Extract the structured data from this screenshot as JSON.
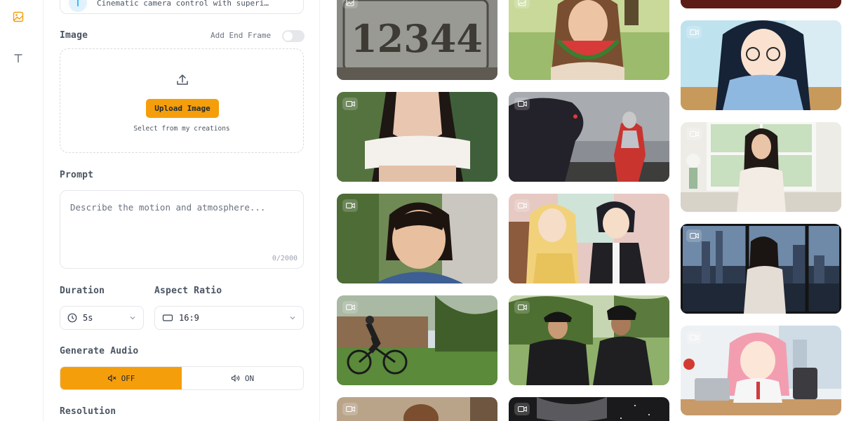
{
  "rail": {
    "items": [
      {
        "icon": "image-icon",
        "active": true
      },
      {
        "icon": "text-icon",
        "active": false
      }
    ]
  },
  "model": {
    "description": "Cinematic camera control with superi…"
  },
  "image_section": {
    "label": "Image",
    "end_frame_label": "Add End Frame",
    "end_frame_enabled": false,
    "upload_button": "Upload Image",
    "select_link": "Select from my creations"
  },
  "prompt": {
    "label": "Prompt",
    "placeholder": "Describe the motion and atmosphere...",
    "value": "",
    "counter": "0/2000"
  },
  "duration": {
    "label": "Duration",
    "value": "5s"
  },
  "aspect_ratio": {
    "label": "Aspect Ratio",
    "value": "16:9"
  },
  "audio": {
    "label": "Generate Audio",
    "off_label": "OFF",
    "on_label": "ON",
    "selected": "OFF"
  },
  "resolution": {
    "label": "Resolution"
  },
  "colors": {
    "accent": "#f59e0b",
    "border": "#e5e7eb"
  },
  "gallery": {
    "tiles": [
      {
        "name": "tile-plate-12344",
        "badge": "image-icon",
        "text": "12344"
      },
      {
        "name": "tile-woman-watermelon",
        "badge": "image-icon"
      },
      {
        "name": "tile-top-right",
        "badge": "video-icon"
      },
      {
        "name": "tile-woman-white-top",
        "badge": "video-icon"
      },
      {
        "name": "tile-monster-ultraman",
        "badge": "video-icon"
      },
      {
        "name": "tile-anime-girl-glasses",
        "badge": "video-icon"
      },
      {
        "name": "tile-little-girl",
        "badge": "video-icon"
      },
      {
        "name": "tile-anime-couple",
        "badge": "video-icon"
      },
      {
        "name": "tile-woman-window",
        "badge": "video-icon"
      },
      {
        "name": "tile-cyclist",
        "badge": "video-icon"
      },
      {
        "name": "tile-two-men-park",
        "badge": "video-icon"
      },
      {
        "name": "tile-city-window",
        "badge": "video-icon"
      },
      {
        "name": "tile-bottom-left",
        "badge": "video-icon"
      },
      {
        "name": "tile-bottom-middle",
        "badge": "video-icon"
      },
      {
        "name": "tile-anime-pink-hair",
        "badge": "video-icon"
      }
    ]
  }
}
